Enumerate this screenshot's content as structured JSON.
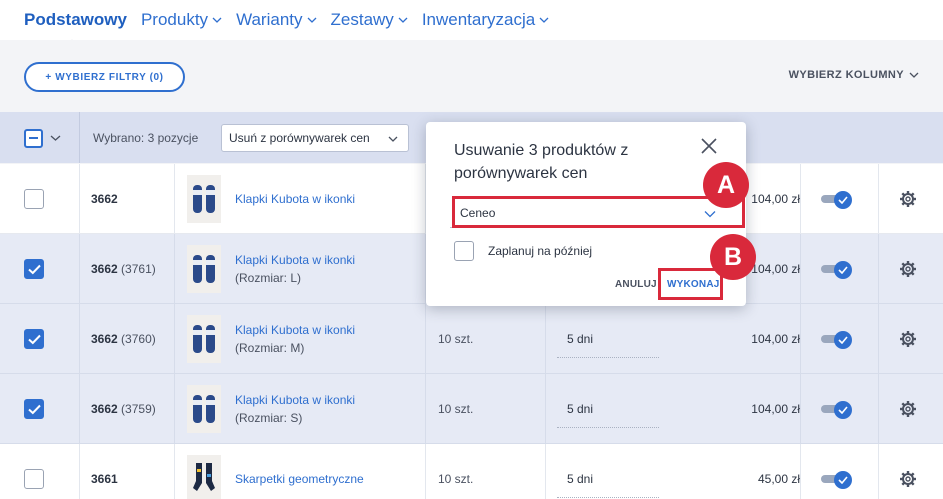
{
  "nav": {
    "items": [
      {
        "label": "Podstawowy",
        "active": true
      },
      {
        "label": "Produkty"
      },
      {
        "label": "Warianty"
      },
      {
        "label": "Zestawy"
      },
      {
        "label": "Inwentaryzacja"
      }
    ]
  },
  "filters": {
    "add_filter_label": "+ WYBIERZ FILTRY (0)",
    "columns_label": "WYBIERZ KOLUMNY"
  },
  "selection": {
    "count_label": "Wybrano: 3 pozycje",
    "action_value": "Usuń z porównywarek cen"
  },
  "rows": [
    {
      "id": "3662",
      "variant_id": "",
      "name": "Klapki Kubota w ikonki",
      "variant": "",
      "qty": "",
      "days": "",
      "price": "104,00 zł",
      "checked": false,
      "enabled": true
    },
    {
      "id": "3662",
      "variant_id": "(3761)",
      "name": "Klapki Kubota w ikonki",
      "variant": "(Rozmiar: L)",
      "qty": "",
      "days": "",
      "price": "104,00 zł",
      "checked": true,
      "enabled": true
    },
    {
      "id": "3662",
      "variant_id": "(3760)",
      "name": "Klapki Kubota w ikonki",
      "variant": "(Rozmiar: M)",
      "qty": "10 szt.",
      "days": "5 dni",
      "price": "104,00 zł",
      "checked": true,
      "enabled": true
    },
    {
      "id": "3662",
      "variant_id": "(3759)",
      "name": "Klapki Kubota w ikonki",
      "variant": "(Rozmiar: S)",
      "qty": "10 szt.",
      "days": "5 dni",
      "price": "104,00 zł",
      "checked": true,
      "enabled": true
    },
    {
      "id": "3661",
      "variant_id": "",
      "name": "Skarpetki geometryczne",
      "variant": "",
      "qty": "10 szt.",
      "days": "5 dni",
      "price": "45,00 zł",
      "checked": false,
      "enabled": true
    }
  ],
  "modal": {
    "title": "Usuwanie 3 produktów z porównywarek cen",
    "select_value": "Ceneo",
    "schedule_label": "Zaplanuj na później",
    "cancel_label": "ANULUJ",
    "confirm_label": "WYKONAJ"
  },
  "annotations": {
    "a": "A",
    "b": "B",
    "color": "#d9293b"
  },
  "colors": {
    "accent": "#2f6fcf",
    "selected_row": "#e6eaf5",
    "selection_bar": "#d9dff0"
  }
}
